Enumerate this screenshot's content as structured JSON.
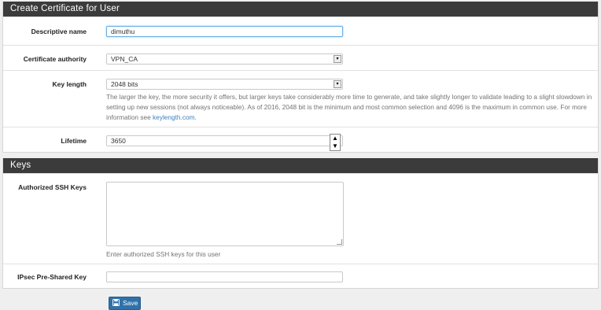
{
  "cert_panel": {
    "title": "Create Certificate for User",
    "descriptive_name": {
      "label": "Descriptive name",
      "value": "dimuthu"
    },
    "certificate_authority": {
      "label": "Certificate authority",
      "selected": "VPN_CA"
    },
    "key_length": {
      "label": "Key length",
      "selected": "2048 bits",
      "help_text": "The larger the key, the more security it offers, but larger keys take considerably more time to generate, and take slightly longer to validate leading to a slight slowdown in setting up new sessions (not always noticeable). As of 2016, 2048 bit is the minimum and most common selection and 4096 is the maximum in common use. For more information see ",
      "help_link": "keylength.com",
      "help_end": "."
    },
    "lifetime": {
      "label": "Lifetime",
      "value": "3650"
    }
  },
  "keys_panel": {
    "title": "Keys",
    "ssh_keys": {
      "label": "Authorized SSH Keys",
      "value": "",
      "help": "Enter authorized SSH keys for this user"
    },
    "ipsec_psk": {
      "label": "IPsec Pre-Shared Key",
      "value": ""
    }
  },
  "actions": {
    "save_label": "Save"
  }
}
